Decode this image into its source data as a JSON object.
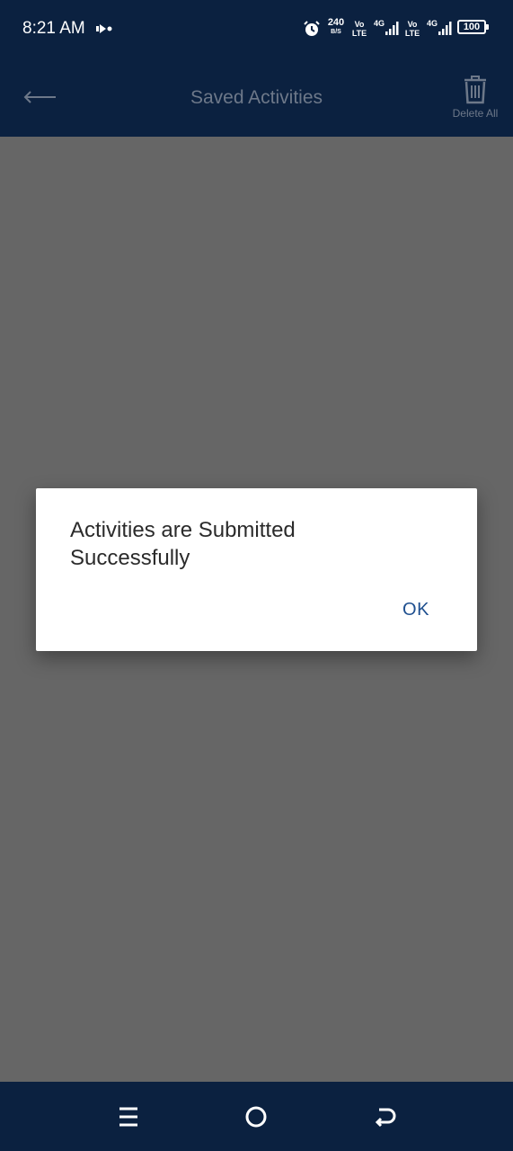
{
  "status_bar": {
    "time": "8:21 AM",
    "speed_value": "240",
    "speed_unit": "B/S",
    "volte1_top": "Vo",
    "volte1_bottom": "LTE",
    "net1": "4G",
    "volte2_top": "Vo",
    "volte2_bottom": "LTE",
    "net2": "4G",
    "battery": "100",
    "icons": [
      "cast-icon",
      "alarm-icon",
      "signal-icon",
      "signal-icon",
      "battery-icon"
    ]
  },
  "app_bar": {
    "title": "Saved Activities",
    "delete_all_label": "Delete All",
    "icons": [
      "back-arrow-icon",
      "trash-icon"
    ]
  },
  "dialog": {
    "message": "Activities are Submitted Successfully",
    "ok_label": "OK"
  },
  "nav_bar": {
    "icons": [
      "menu-icon",
      "home-icon",
      "back-icon"
    ]
  },
  "colors": {
    "bar_background": "#0b2140",
    "overlay": "#666666",
    "accent": "#1e4f8f"
  }
}
